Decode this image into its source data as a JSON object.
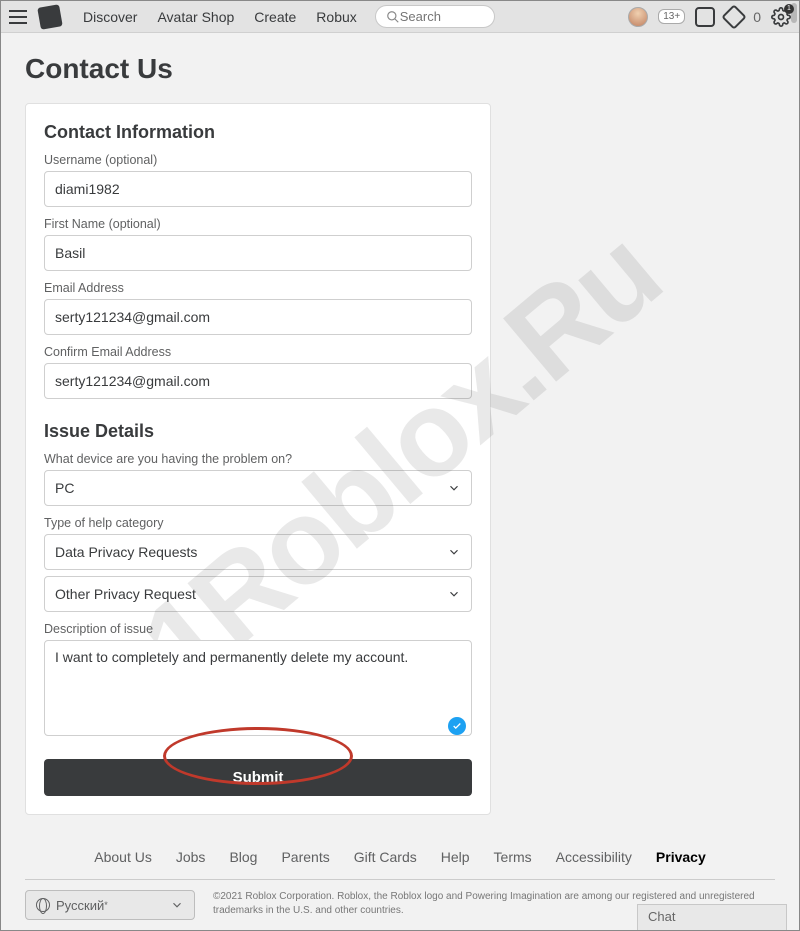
{
  "nav": {
    "links": [
      "Discover",
      "Avatar Shop",
      "Create",
      "Robux"
    ],
    "search_placeholder": "Search",
    "age_badge": "13+",
    "robux_count": "0",
    "gear_badge": "1"
  },
  "page": {
    "title": "Contact Us"
  },
  "form": {
    "section_contact": "Contact Information",
    "username_label": "Username (optional)",
    "username_value": "diami1982",
    "firstname_label": "First Name (optional)",
    "firstname_value": "Basil",
    "email_label": "Email Address",
    "email_value": "serty121234@gmail.com",
    "confirm_email_label": "Confirm Email Address",
    "confirm_email_value": "serty121234@gmail.com",
    "section_issue": "Issue Details",
    "device_label": "What device are you having the problem on?",
    "device_value": "PC",
    "category_label": "Type of help category",
    "category_value": "Data Privacy Requests",
    "subcategory_value": "Other Privacy Request",
    "description_label": "Description of issue",
    "description_value": "I want to completely and permanently delete my account.",
    "submit_label": "Submit"
  },
  "footer": {
    "links": [
      "About Us",
      "Jobs",
      "Blog",
      "Parents",
      "Gift Cards",
      "Help",
      "Terms",
      "Accessibility",
      "Privacy"
    ],
    "active_link": "Privacy",
    "language": "Русский",
    "legal": "©2021 Roblox Corporation. Roblox, the Roblox logo and Powering Imagination are among our registered and unregistered trademarks in the U.S. and other countries.",
    "chat": "Chat"
  },
  "watermark": "1Roblox.Ru"
}
